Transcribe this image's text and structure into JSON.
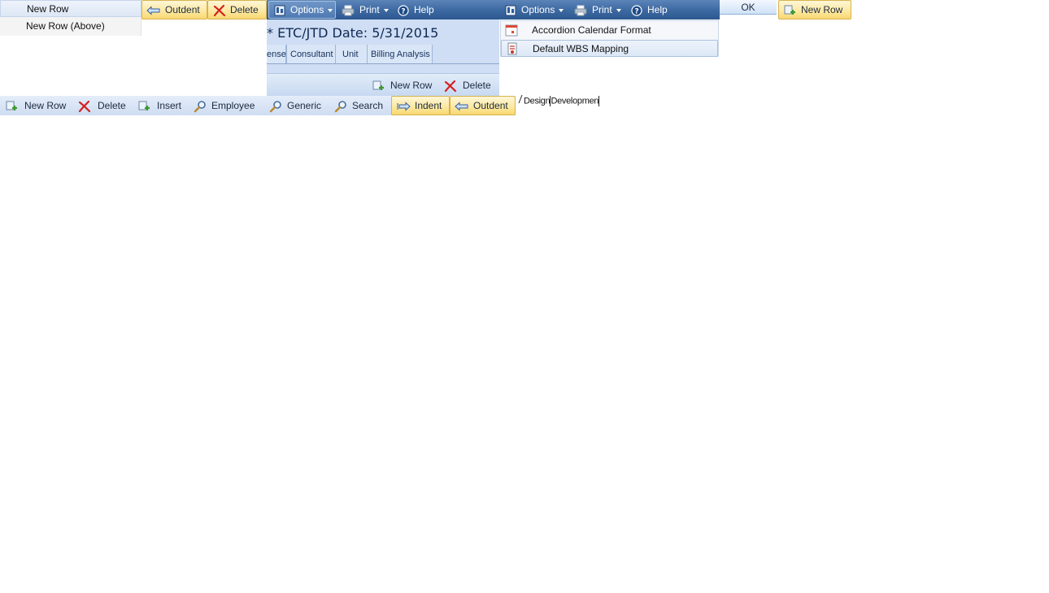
{
  "context_menu": {
    "items": [
      {
        "label": "New Row"
      },
      {
        "label": "New Row (Above)"
      }
    ]
  },
  "top_buttons": {
    "outdent": "Outdent",
    "delete": "Delete",
    "new_row": "New Row",
    "ok": "OK"
  },
  "toolbar_a": {
    "options": "Options",
    "print": "Print",
    "help": "Help"
  },
  "toolbar_b": {
    "options": "Options",
    "print": "Print",
    "help": "Help"
  },
  "header": {
    "title": "* ETC/JTD Date: 5/31/2015"
  },
  "tabs": [
    {
      "label": "ense"
    },
    {
      "label": "Consultant"
    },
    {
      "label": "Unit"
    },
    {
      "label": "Billing Analysis"
    }
  ],
  "sub_toolbar": {
    "new_row": "New Row",
    "delete": "Delete"
  },
  "options_menu": {
    "items": [
      {
        "label": "Accordion Calendar Format",
        "icon": "calendar-icon"
      },
      {
        "label": "Default WBS Mapping",
        "icon": "mapping-icon"
      }
    ]
  },
  "bottom_toolbar": {
    "new_row": "New Row",
    "delete": "Delete",
    "insert": "Insert",
    "employee": "Employee",
    "generic": "Generic",
    "search": "Search",
    "indent": "Indent",
    "outdent": "Outdent"
  },
  "wbs_text": {
    "part1": "Design",
    "part2": "Developmen"
  },
  "colors": {
    "toolbar_dark": "#3e6aa3",
    "button_yellow": "#fde9a4",
    "panel_blue": "#cfdef4",
    "delete_red": "#d42020",
    "add_green": "#3a9a2e"
  }
}
